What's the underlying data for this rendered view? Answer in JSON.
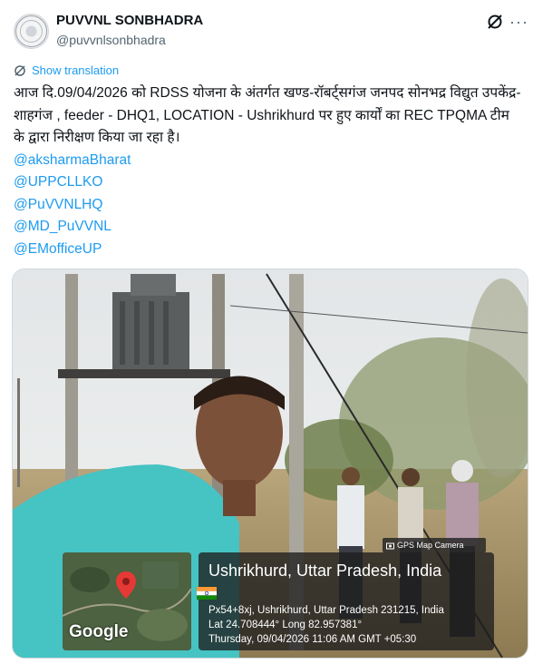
{
  "account": {
    "display_name": "PUVVNL SONBHADRA",
    "handle": "@puvvnlsonbhadra"
  },
  "actions": {
    "show_translation": "Show translation"
  },
  "post": {
    "text": "आज दि.09/04/2026 को RDSS योजना के अंतर्गत खण्ड-रॉबर्ट्सगंज जनपद सोनभद्र विद्युत उपकेंद्र- शाहगंज , feeder - DHQ1, LOCATION - Ushrikhurd पर हुए कार्यों का REC TPQMA टीम के द्वारा निरीक्षण किया जा रहा है।",
    "mentions": [
      "@aksharmaBharat",
      "@UPPCLLKO",
      "@PuVVNLHQ",
      "@MD_PuVVNL",
      "@EMofficeUP"
    ]
  },
  "photo": {
    "app_badge": "GPS Map Camera",
    "map_brand": "Google",
    "location_title": "Ushrikhurd, Uttar Pradesh, India",
    "address": "Px54+8xj, Ushrikhurd, Uttar Pradesh 231215, India",
    "coordinates": "Lat 24.708444° Long 82.957381°",
    "timestamp": "Thursday, 09/04/2026 11:06 AM GMT +05:30"
  },
  "icons": {
    "avatar": "org-logo-icon",
    "grok": "grok-icon",
    "more": "more-icon",
    "translate": "translate-icon",
    "pin": "map-pin-icon",
    "flag": "india-flag-icon"
  },
  "colors": {
    "link": "#1d9bf0",
    "secondary_text": "#536471",
    "primary_text": "#0f1419"
  }
}
